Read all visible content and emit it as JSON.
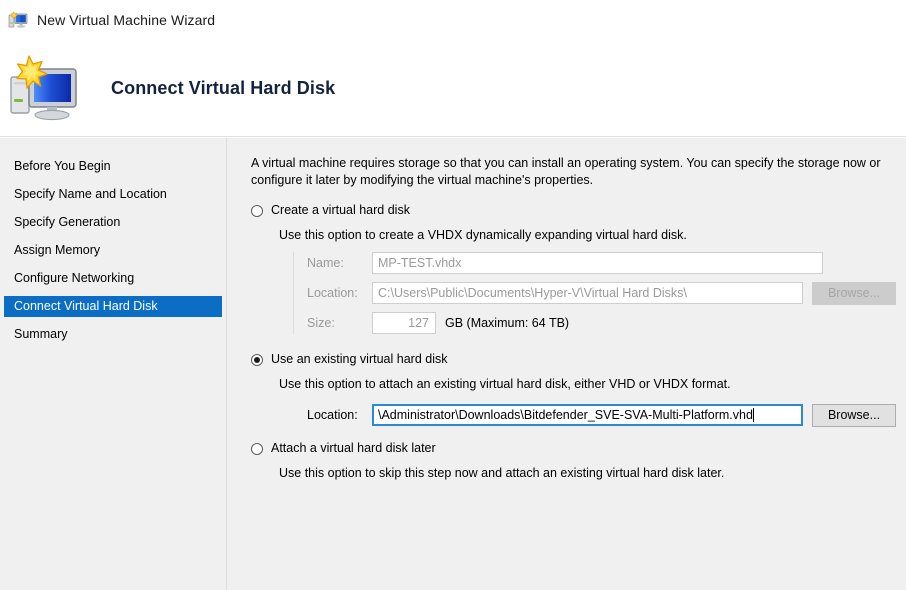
{
  "window": {
    "title": "New Virtual Machine Wizard",
    "icon": "virtual-machine-icon"
  },
  "header": {
    "title": "Connect Virtual Hard Disk",
    "icon": "virtual-machine-icon-large"
  },
  "colors": {
    "selection": "#0b6ec4",
    "focus_border": "#2a8ad4",
    "body_background": "#f0f0f0",
    "disabled_text": "#9a9a9a"
  },
  "sidebar": {
    "items": [
      {
        "label": "Before You Begin",
        "selected": false
      },
      {
        "label": "Specify Name and Location",
        "selected": false
      },
      {
        "label": "Specify Generation",
        "selected": false
      },
      {
        "label": "Assign Memory",
        "selected": false
      },
      {
        "label": "Configure Networking",
        "selected": false
      },
      {
        "label": "Connect Virtual Hard Disk",
        "selected": true
      },
      {
        "label": "Summary",
        "selected": false
      }
    ]
  },
  "main": {
    "intro": "A virtual machine requires storage so that you can install an operating system. You can specify the storage now or configure it later by modifying the virtual machine's properties.",
    "options": [
      {
        "label": "Create a virtual hard disk",
        "description": "Use this option to create a VHDX dynamically expanding virtual hard disk.",
        "checked": false
      },
      {
        "label": "Use an existing virtual hard disk",
        "description": "Use this option to attach an existing virtual hard disk, either VHD or VHDX format.",
        "checked": true
      },
      {
        "label": "Attach a virtual hard disk later",
        "description": "Use this option to skip this step now and attach an existing virtual hard disk later.",
        "checked": false
      }
    ],
    "create_fields": {
      "name_label": "Name:",
      "name_value": "MP-TEST.vhdx",
      "location_label": "Location:",
      "location_value": "C:\\Users\\Public\\Documents\\Hyper-V\\Virtual Hard Disks\\",
      "browse_label": "Browse...",
      "size_label": "Size:",
      "size_value": "127",
      "size_suffix": "GB (Maximum: 64 TB)"
    },
    "existing_fields": {
      "location_label": "Location:",
      "location_value": "\\Administrator\\Downloads\\Bitdefender_SVE-SVA-Multi-Platform.vhd",
      "browse_label": "Browse..."
    }
  }
}
